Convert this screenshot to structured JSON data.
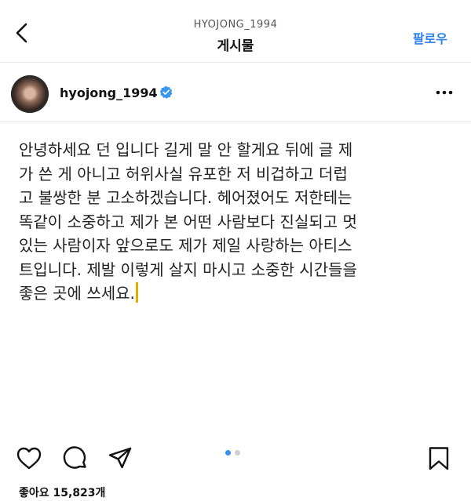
{
  "header": {
    "account_id": "HYOJONG_1994",
    "title": "게시물",
    "follow_label": "팔로우"
  },
  "post": {
    "username": "hyojong_1994",
    "verified": true,
    "caption": "안녕하세요 던 입니다 길게 말 안 할게요 뒤에 글 제\n가 쓴 게 아니고 허위사실 유포한 저 비겁하고 더럽\n고 불쌍한 분 고소하겠습니다. 헤어졌어도 저한테는\n똑같이 소중하고 제가 본 어떤 사람보다 진실되고 멋\n있는 사람이자 앞으로도 제가 제일 사랑하는 아티스\n트입니다. 제발 이렇게 살지 마시고 소중한 시간들을\n좋은 곳에 쓰세요.",
    "likes_text": "좋아요 15,823개"
  },
  "carousel": {
    "count": 2,
    "active_index": 0
  },
  "colors": {
    "accent": "#2f80ed",
    "verified_badge": "#3897f0",
    "text_cursor": "#e0b000"
  },
  "icons": [
    "back-arrow-icon",
    "verified-badge-icon",
    "more-options-icon",
    "heart-icon",
    "comment-icon",
    "share-icon",
    "bookmark-icon"
  ]
}
